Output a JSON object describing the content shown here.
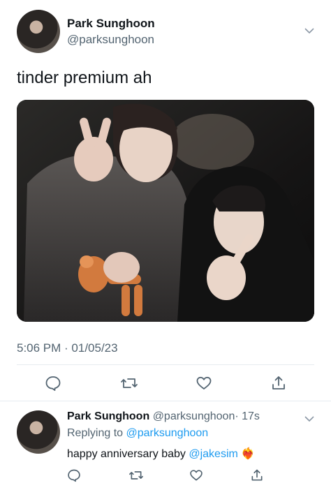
{
  "tweet": {
    "author_name": "Park Sunghoon",
    "author_handle": "@parksunghoon",
    "text": "tinder premium ah",
    "timestamp": "5:06 PM · 01/05/23",
    "photo_alt_icon": "photo"
  },
  "reply": {
    "author_name": "Park Sunghoon",
    "author_handle": "@parksunghoon",
    "age": "· 17s",
    "replying_prefix": "Replying to",
    "replying_to": "@parksunghoon",
    "text": "happy anniversary baby",
    "mention": "@jakesim",
    "emoji": "❤️‍🔥"
  },
  "actions": {
    "reply_icon": "speech-bubble-icon",
    "retweet_icon": "retweet-icon",
    "like_icon": "heart-icon",
    "share_icon": "share-icon"
  },
  "colors": {
    "link": "#1d9bf0",
    "secondary_text": "#536471",
    "divider": "#e6ecf0"
  }
}
